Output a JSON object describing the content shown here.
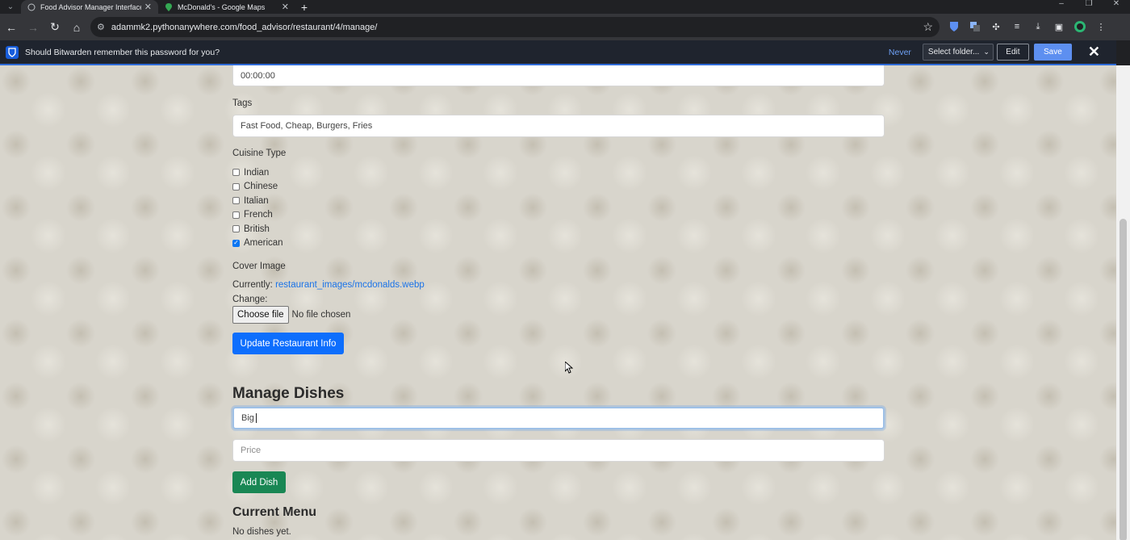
{
  "browser": {
    "tabs": [
      {
        "title": "Food Advisor Manager Interface",
        "active": true
      },
      {
        "title": "McDonald's - Google Maps",
        "active": false
      }
    ],
    "url": "adammk2.pythonanywhere.com/food_advisor/restaurant/4/manage/"
  },
  "bitwarden": {
    "message": "Should Bitwarden remember this password for you?",
    "never_label": "Never",
    "folder_select": "Select folder...",
    "edit_label": "Edit",
    "save_label": "Save"
  },
  "form": {
    "time_value": "00:00:00",
    "tags_label": "Tags",
    "tags_value": "Fast Food, Cheap, Burgers, Fries",
    "cuisine_label": "Cuisine Type",
    "cuisines": [
      {
        "label": "Indian",
        "checked": false
      },
      {
        "label": "Chinese",
        "checked": false
      },
      {
        "label": "Italian",
        "checked": false
      },
      {
        "label": "French",
        "checked": false
      },
      {
        "label": "British",
        "checked": false
      },
      {
        "label": "American",
        "checked": true
      }
    ],
    "cover_label": "Cover Image",
    "currently_label": "Currently:",
    "current_image": "restaurant_images/mcdonalds.webp",
    "change_label": "Change:",
    "choose_file_label": "Choose file",
    "no_file_text": "No file chosen",
    "update_button": "Update Restaurant Info"
  },
  "dishes": {
    "heading": "Manage Dishes",
    "name_value": "Big",
    "price_placeholder": "Price",
    "add_button": "Add Dish",
    "menu_heading": "Current Menu",
    "empty_text": "No dishes yet."
  },
  "colors": {
    "primary": "#0d6efd",
    "success": "#198754",
    "link": "#1a73e8",
    "bitwarden_blue": "#175ddc"
  }
}
